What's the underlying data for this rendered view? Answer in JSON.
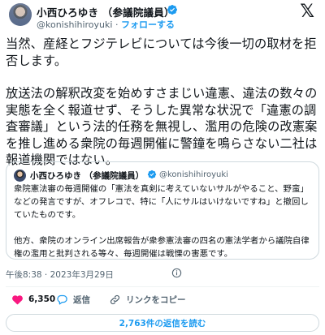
{
  "author": {
    "name": "小西ひろゆき （参議院議員）",
    "handle": "@konishihiroyuki",
    "separator": "·",
    "follow_label": "フォローする"
  },
  "logo": "𝕏",
  "tweet": {
    "paragraph1": "当然、産経とフジテレビについては今後一切の取材を拒否します。",
    "paragraph2": "放送法の解釈改変を始めすさまじい違憲、違法の数々の実態を全く報道せず、そうした異常な状況で「違憲の調査審議」という法的任務を無視し、濫用の危険の改憲案を推し進める衆院の毎週開催に警鐘を鳴らさない二社は報道機関ではない。"
  },
  "quote": {
    "name": "小西ひろゆき （参議院議員）",
    "handle": "@konishihiroyuki",
    "paragraph1": "衆院憲法審の毎週開催の「憲法を真剣に考えていないサルがやること、野蛮」などの発言ですが、オフレコで、特に「人にサルはいけないですね」と撤回していたものです。",
    "paragraph2": "他方、衆院のオンライン出席報告が衆参憲法審の四名の憲法学者から議院自律権の濫用と批判される等々、毎週開催は戦慄の害悪です。"
  },
  "timestamp": "午後8:38 · 2023年3月29日",
  "actions": {
    "likes": "6,350",
    "reply_label": "返信",
    "copy_label": "リンクをコピー"
  },
  "read_replies_label": "2,763件の返信を読む",
  "colors": {
    "accent": "#1d9bf0",
    "like": "#f91880",
    "muted": "#536471"
  },
  "icons": [
    "verified-badge-icon",
    "x-logo",
    "info-icon",
    "heart-icon",
    "reply-icon",
    "link-icon"
  ]
}
